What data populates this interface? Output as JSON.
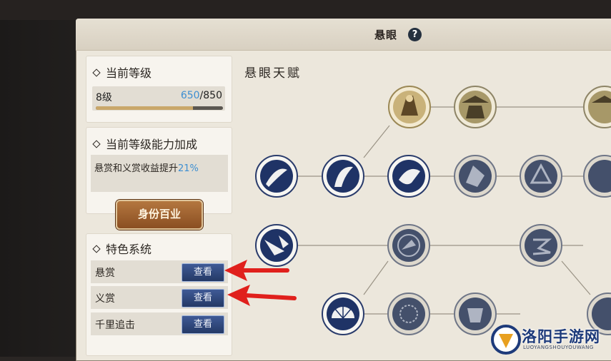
{
  "window": {
    "title": "悬眼",
    "help_label": "?"
  },
  "level_section": {
    "title": "当前等级",
    "level": "8级",
    "current_xp": "650",
    "separator": "/",
    "max_xp": "850",
    "progress": 0.765
  },
  "bonus_section": {
    "title": "当前等级能力加成",
    "text": "悬赏和义赏收益提升",
    "percent": "21%"
  },
  "profession_button": {
    "label": "身份百业"
  },
  "feature_section": {
    "title": "特色系统",
    "rows": [
      {
        "label": "悬赏",
        "button": "查看"
      },
      {
        "label": "义赏",
        "button": "查看"
      },
      {
        "label": "千里追击",
        "button": "查看"
      }
    ]
  },
  "talent_tree": {
    "title": "悬眼天赋"
  },
  "watermark": {
    "text": "洛阳手游网",
    "sub": "LUOYANGSHOUYOUWANG"
  },
  "colors": {
    "accent_blue": "#3c8ed2",
    "button_blue": "#2d4478",
    "button_brown": "#9a5a2c",
    "arrow_red": "#e0201c",
    "node_dark": "#1e2c4e",
    "node_gold": "#a38e5c"
  }
}
